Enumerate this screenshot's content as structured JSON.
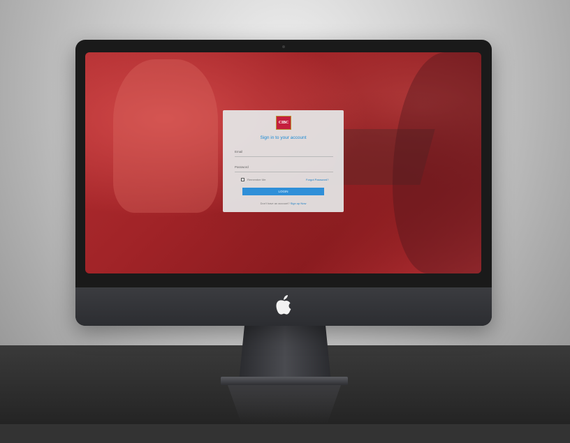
{
  "brand": {
    "logo_text": "CIBC",
    "primary_color": "#c41f3e",
    "link_color": "#1a7ec4",
    "button_color": "#2f8fd8"
  },
  "login": {
    "title": "Sign in to your account",
    "email_label": "Email",
    "password_label": "Password",
    "remember_label": "Remember Me",
    "forgot_label": "Forgot Password?",
    "login_button": "LOGIN",
    "signup_prompt": "Don't have an account?",
    "signup_link": "Sign up Now"
  },
  "icons": {
    "device_logo": "apple-icon",
    "checkbox": "checkbox-unchecked"
  }
}
